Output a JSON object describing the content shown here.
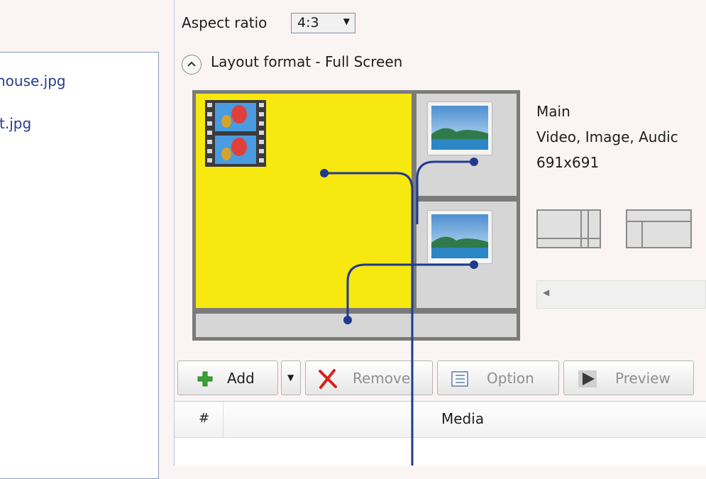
{
  "files": [
    "house.jpg",
    "t.jpg"
  ],
  "aspect": {
    "label": "Aspect ratio",
    "value": "4:3"
  },
  "layout": {
    "title": "Layout format - Full Screen",
    "region_info": {
      "name": "Main",
      "types": "Video, Image, Audic",
      "size": "691x691"
    }
  },
  "toolbar": {
    "add": "Add",
    "remove": "Remove",
    "option": "Option",
    "preview": "Preview"
  },
  "grid": {
    "columns": [
      "#",
      "Media"
    ]
  },
  "colors": {
    "main_region": "#f7e80f",
    "connector": "#1f3a8f",
    "link_text": "#2b3a8c"
  },
  "icons": [
    "chevron-up-icon",
    "dropdown-arrow-icon",
    "video-film-icon",
    "image-landscape-icon",
    "plus-icon",
    "remove-x-icon",
    "option-list-icon",
    "play-icon"
  ]
}
